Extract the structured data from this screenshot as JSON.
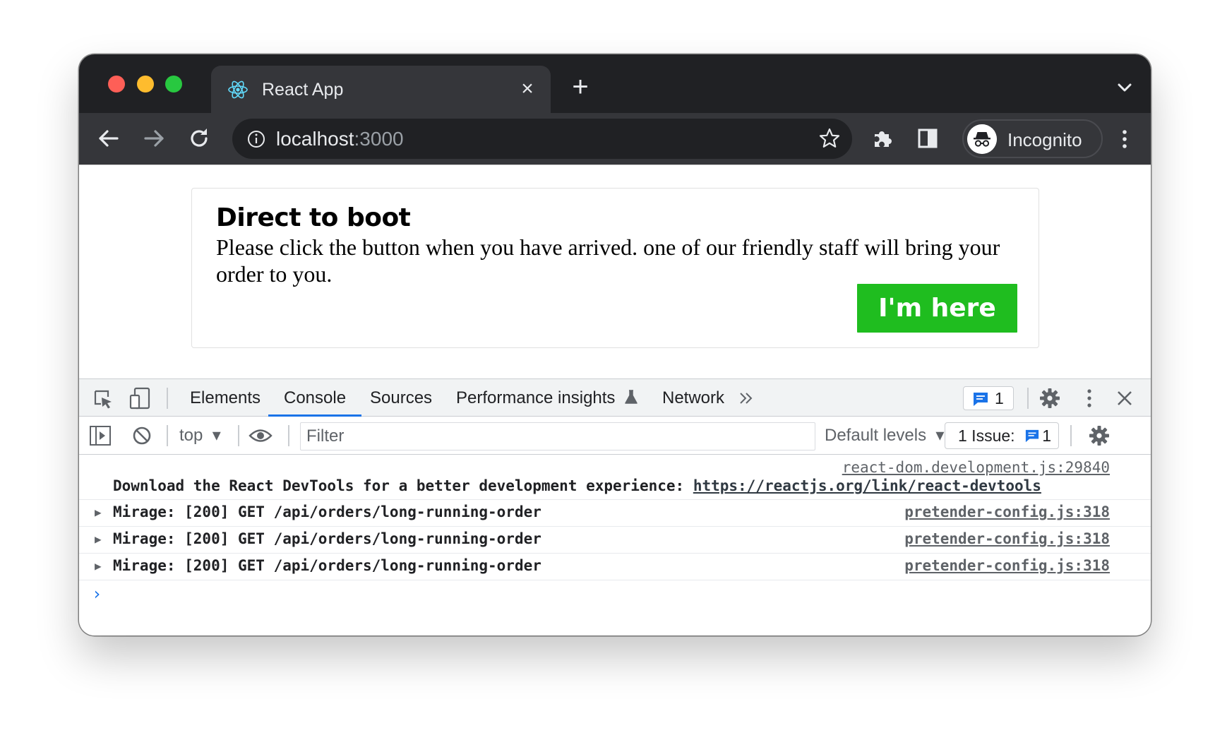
{
  "browser": {
    "tab_title": "React App",
    "url_host": "localhost",
    "url_port": ":3000",
    "profile_label": "Incognito"
  },
  "page": {
    "title": "Direct to boot",
    "body": "Please click the button when you have arrived. one of our friendly staff will bring your order to you.",
    "button_label": "I'm here",
    "button_color": "#1fbd1f"
  },
  "devtools": {
    "tabs": [
      "Elements",
      "Console",
      "Sources",
      "Performance insights",
      "Network"
    ],
    "active_tab": "Console",
    "issues_badge_count": "1",
    "context": "top",
    "filter_placeholder": "Filter",
    "levels": "Default levels",
    "issue_label": "1 Issue:",
    "issue_count": "1",
    "console_messages": [
      {
        "source": "react-dom.development.js:29840",
        "text": "Download the React DevTools for a better development experience: ",
        "link": "https://reactjs.org/link/react-devtools"
      },
      {
        "text": "Mirage: [200] GET /api/orders/long-running-order",
        "source": "pretender-config.js:318"
      },
      {
        "text": "Mirage: [200] GET /api/orders/long-running-order",
        "source": "pretender-config.js:318"
      },
      {
        "text": "Mirage: [200] GET /api/orders/long-running-order",
        "source": "pretender-config.js:318"
      }
    ],
    "prompt": "›"
  }
}
